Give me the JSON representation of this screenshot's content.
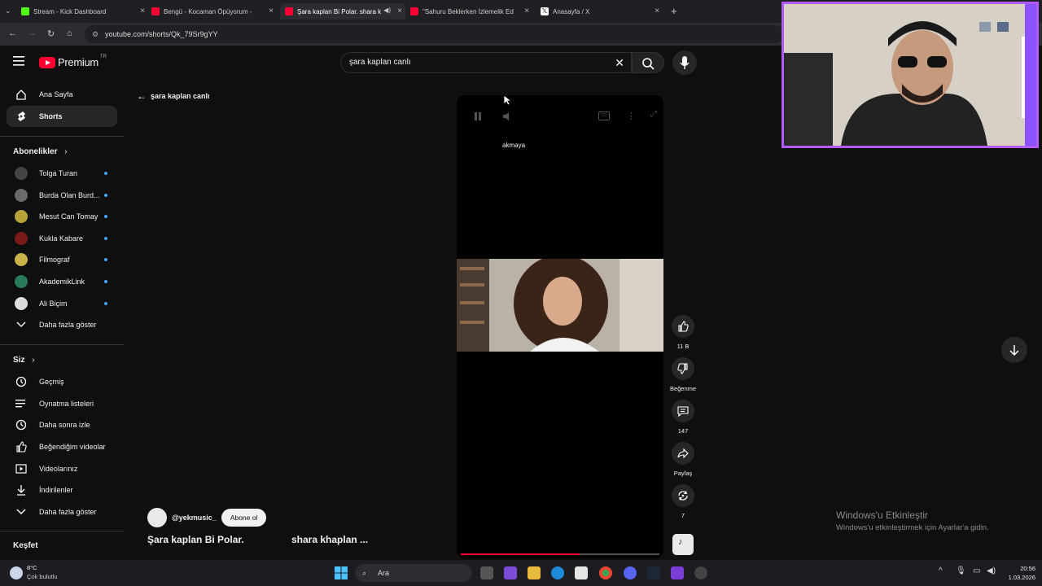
{
  "browser": {
    "tabs": [
      {
        "label": "Stream - Kick Dashboard",
        "color": "#53fc18"
      },
      {
        "label": "Bengü - Kocaman Öpüyorum -",
        "color": "#ff0033"
      },
      {
        "label": "Şara kaplan Bi Polar. shara k",
        "color": "#ff0033"
      },
      {
        "label": "\"Sahuru Beklerken İzlemelik Ed",
        "color": "#ff0033"
      },
      {
        "label": "Anasayfa / X",
        "color": "#ffffff"
      }
    ],
    "url": "youtube.com/shorts/Qk_79Sr9gYY"
  },
  "header": {
    "logo_text": "Premium",
    "logo_sup": "TR",
    "search_value": "şara kaplan canlı"
  },
  "sidebar": {
    "main": [
      {
        "label": "Ana Sayfa",
        "icon": "home-icon"
      },
      {
        "label": "Shorts",
        "icon": "shorts-icon"
      }
    ],
    "subs_title": "Abonelikler",
    "subs": [
      {
        "label": "Tolga Turan",
        "color": "#444"
      },
      {
        "label": "Burda Olan Burd...",
        "color": "#6a6a6a"
      },
      {
        "label": "Mesut Can Tomay",
        "color": "#b8a23a"
      },
      {
        "label": "Kukla Kabare",
        "color": "#7a1a1a"
      },
      {
        "label": "Filmograf",
        "color": "#c9b24a"
      },
      {
        "label": "AkademikLink",
        "color": "#2a7a5a"
      },
      {
        "label": "Ali Biçim",
        "color": "#dddddd"
      }
    ],
    "subs_more": "Daha fazla göster",
    "you_title": "Siz",
    "you": [
      {
        "label": "Geçmiş",
        "icon": "history-icon"
      },
      {
        "label": "Oynatma listeleri",
        "icon": "playlist-icon"
      },
      {
        "label": "Daha sonra izle",
        "icon": "clock-icon"
      },
      {
        "label": "Beğendiğim videolar",
        "icon": "like-icon"
      },
      {
        "label": "Videolarınız",
        "icon": "video-icon"
      },
      {
        "label": "İndirilenler",
        "icon": "download-icon"
      },
      {
        "label": "Daha fazla göster",
        "icon": "chevron-down-icon"
      }
    ],
    "explore_title": "Keşfet"
  },
  "shorts": {
    "back_label": "şara kaplan canlı",
    "caption_word": "akmaya",
    "channel": "@yekmusic_",
    "subscribe": "Abone ol",
    "title_1": "Şara kaplan Bi Polar.",
    "title_2": "shara khaplan ...",
    "progress": 0.6,
    "likes": "11 B",
    "dislike": "Beğenme",
    "comments": "147",
    "share": "Paylaş",
    "remix": "7"
  },
  "watermark": {
    "title": "Windows'u Etkinleştir",
    "sub": "Windows'u etkinleştirmek için Ayarlar'a gidin."
  },
  "taskbar": {
    "temp": "8°C",
    "weather": "Çok bulutlu",
    "search": "Ara",
    "time": "20:56",
    "date": "1.03.2026"
  }
}
